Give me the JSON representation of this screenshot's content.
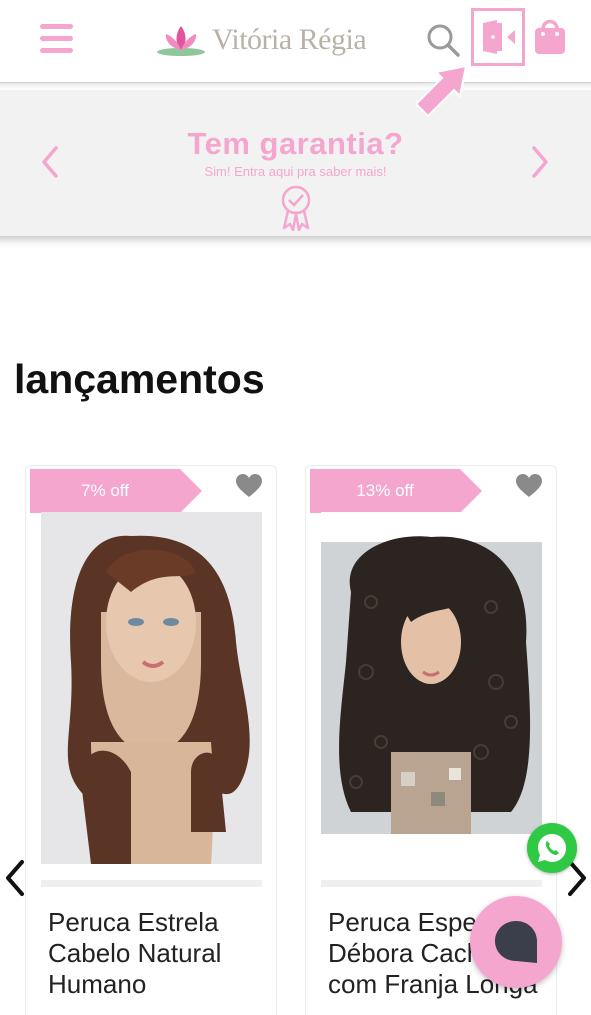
{
  "header": {
    "logo_text": "Vitória Régia",
    "accent_color": "#f4a6cf"
  },
  "banner": {
    "title": "Tem garantia?",
    "subtitle": "Sim! Entra aqui pra saber mais!"
  },
  "section": {
    "title": "lançamentos"
  },
  "products": [
    {
      "discount": "7% off",
      "title": "Peruca Estrela Cabelo Natural Humano"
    },
    {
      "discount": "13% off",
      "title": "Peruca Especial Débora Cacheada com Franja Longa"
    }
  ],
  "icons": {
    "menu": "hamburger-menu-icon",
    "search": "search-icon",
    "login": "door-login-icon",
    "bag": "shopping-bag-icon",
    "favorite": "heart-icon",
    "whatsapp": "whatsapp-icon",
    "chat": "chat-bubble-icon"
  }
}
